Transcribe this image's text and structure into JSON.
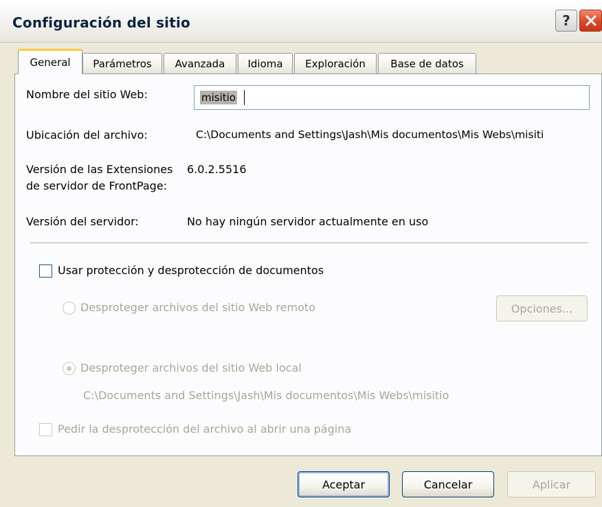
{
  "window": {
    "title": "Configuración del sitio",
    "help_label": "?"
  },
  "tabs": [
    {
      "label": "General"
    },
    {
      "label": "Parámetros"
    },
    {
      "label": "Avanzada"
    },
    {
      "label": "Idioma"
    },
    {
      "label": "Exploración"
    },
    {
      "label": "Base de datos"
    }
  ],
  "general": {
    "site_name_label": "Nombre del sitio Web:",
    "site_name_value": "misitio",
    "file_location_label": "Ubicación del archivo:",
    "file_location_value": "C:\\Documents and Settings\\Jash\\Mis documentos\\Mis Webs\\misiti",
    "extensions_version_label_line1": "Versión de las Extensiones",
    "extensions_version_label_line2": "de servidor de FrontPage:",
    "extensions_version_value": "6.0.2.5516",
    "server_version_label": "Versión del servidor:",
    "server_version_value": "No hay ningún servidor actualmente en uso"
  },
  "source_control": {
    "use_checkout_label": "Usar protección y desprotección de documentos",
    "use_checkout_checked": false,
    "remote_label": "Desproteger archivos del sitio Web remoto",
    "options_button": "Opciones...",
    "local_label": "Desproteger archivos del sitio Web local",
    "local_selected": true,
    "local_path": "C:\\Documents and Settings\\Jash\\Mis documentos\\Mis Webs\\misitio",
    "prompt_on_open_label": "Pedir la desprotección del archivo al abrir una página"
  },
  "footer": {
    "ok_button": "Aceptar",
    "cancel_button": "Cancelar",
    "apply_button": "Aplicar"
  }
}
